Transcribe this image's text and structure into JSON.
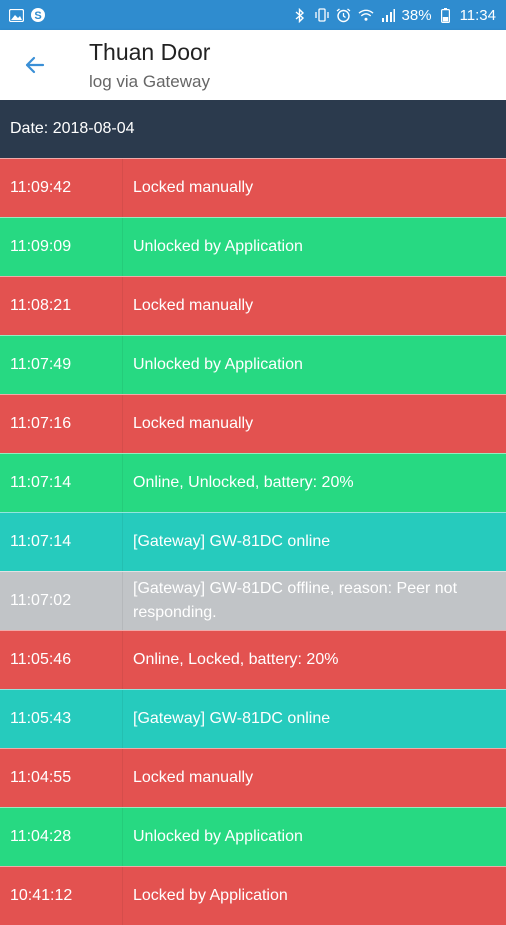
{
  "status_bar": {
    "battery": "38%",
    "time": "11:34",
    "left_icons": [
      "gallery-icon",
      "skype-icon"
    ],
    "right_icons": [
      "bluetooth-icon",
      "vibrate-icon",
      "alarm-icon",
      "wifi-icon",
      "signal-icon"
    ]
  },
  "header": {
    "title": "Thuan Door",
    "subtitle": "log via Gateway",
    "back_icon": "arrow-left-icon"
  },
  "date_label": "Date: 2018-08-04",
  "colors": {
    "red": "#e35250",
    "green": "#27d982",
    "teal": "#26cbbd",
    "gray": "#c1c4c7",
    "date_bar": "#2b3a4d",
    "status_bar": "#2f8ccf"
  },
  "log": [
    {
      "time": "11:09:42",
      "message": "Locked manually",
      "status": "red"
    },
    {
      "time": "11:09:09",
      "message": "Unlocked by Application",
      "status": "green"
    },
    {
      "time": "11:08:21",
      "message": "Locked manually",
      "status": "red"
    },
    {
      "time": "11:07:49",
      "message": "Unlocked by Application",
      "status": "green"
    },
    {
      "time": "11:07:16",
      "message": "Locked manually",
      "status": "red"
    },
    {
      "time": "11:07:14",
      "message": "Online, Unlocked, battery: 20%",
      "status": "green"
    },
    {
      "time": "11:07:14",
      "message": "[Gateway] GW-81DC online",
      "status": "teal"
    },
    {
      "time": "11:07:02",
      "message": "[Gateway] GW-81DC offline, reason: Peer not responding.",
      "status": "gray"
    },
    {
      "time": "11:05:46",
      "message": "Online, Locked, battery: 20%",
      "status": "red"
    },
    {
      "time": "11:05:43",
      "message": "[Gateway] GW-81DC online",
      "status": "teal"
    },
    {
      "time": "11:04:55",
      "message": "Locked manually",
      "status": "red"
    },
    {
      "time": "11:04:28",
      "message": "Unlocked by Application",
      "status": "green"
    },
    {
      "time": "10:41:12",
      "message": "Locked by Application",
      "status": "red"
    }
  ]
}
